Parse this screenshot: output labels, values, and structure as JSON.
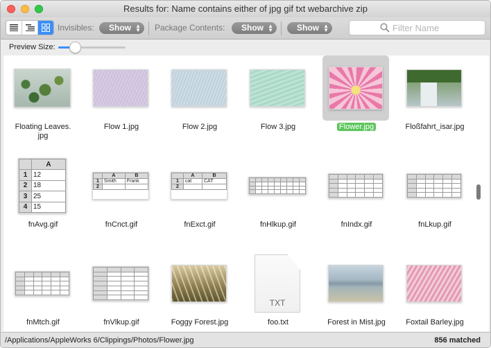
{
  "window": {
    "title": "Results for: Name contains either of jpg gif txt webarchive zip"
  },
  "toolbar": {
    "invisibles_label": "Invisibles:",
    "invisibles_value": "Show",
    "package_label": "Package Contents:",
    "package_value": "Show",
    "third_value": "Show",
    "search_placeholder": "Filter Name"
  },
  "preview": {
    "label": "Preview Size:",
    "size_fraction": 0.25
  },
  "files": [
    {
      "name": "Floating Leaves.\njpg",
      "kind": "photo-leaves"
    },
    {
      "name": "Flow 1.jpg",
      "kind": "flow-purple"
    },
    {
      "name": "Flow 2.jpg",
      "kind": "flow-blue"
    },
    {
      "name": "Flow 3.jpg",
      "kind": "flow-teal"
    },
    {
      "name": "Flower.jpg",
      "kind": "photo-flower",
      "selected": true
    },
    {
      "name": "Floßfahrt_isar.jpg",
      "kind": "photo-river"
    },
    {
      "name": "fnAvg.gif",
      "kind": "sheet-avg"
    },
    {
      "name": "fnCnct.gif",
      "kind": "sheet-cnct"
    },
    {
      "name": "fnExct.gif",
      "kind": "sheet-exct"
    },
    {
      "name": "fnHlkup.gif",
      "kind": "sheet-wide"
    },
    {
      "name": "fnIndx.gif",
      "kind": "sheet-grid"
    },
    {
      "name": "fnLkup.gif",
      "kind": "sheet-grid"
    },
    {
      "name": "fnMtch.gif",
      "kind": "sheet-grid"
    },
    {
      "name": "fnVlkup.gif",
      "kind": "sheet-vlk"
    },
    {
      "name": "Foggy Forest.jpg",
      "kind": "photo-forest"
    },
    {
      "name": "foo.txt",
      "kind": "txt-doc"
    },
    {
      "name": "Forest in Mist.jpg",
      "kind": "photo-mist"
    },
    {
      "name": "Foxtail Barley.jpg",
      "kind": "photo-barley"
    }
  ],
  "sheets": {
    "avg": {
      "header": "A",
      "rows": [
        [
          "1",
          "12"
        ],
        [
          "2",
          "18"
        ],
        [
          "3",
          "25"
        ],
        [
          "4",
          "15"
        ]
      ]
    },
    "cnct": {
      "headers": [
        "A",
        "B"
      ],
      "rows": [
        [
          "1",
          "Smith",
          "Frank"
        ],
        [
          "2",
          "",
          ""
        ]
      ]
    },
    "exct": {
      "headers": [
        "A",
        "B"
      ],
      "rows": [
        [
          "1",
          "cat",
          "CAT"
        ],
        [
          "2",
          "",
          ""
        ]
      ]
    }
  },
  "txt_label": "TXT",
  "status": {
    "path": "/Applications/AppleWorks 6/Clippings/Photos/Flower.jpg",
    "count": "856 matched"
  }
}
